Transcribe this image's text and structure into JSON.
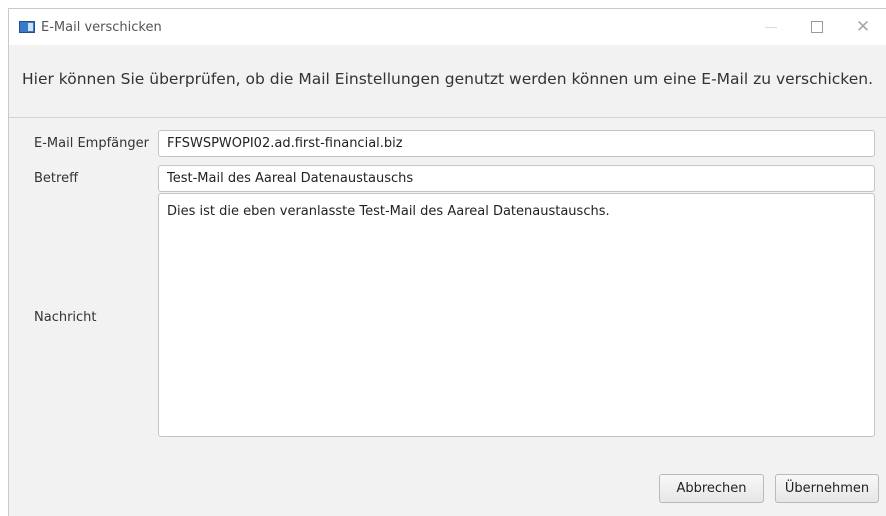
{
  "window": {
    "title": "E-Mail verschicken",
    "icon": "app-window-icon"
  },
  "header": {
    "description": "Hier können Sie überprüfen, ob die Mail Einstellungen genutzt werden können um eine E-Mail zu verschicken."
  },
  "form": {
    "recipient_label": "E-Mail Empfänger",
    "recipient_value": "FFSWSPWOPI02.ad.first-financial.biz",
    "subject_label": "Betreff",
    "subject_value": "Test-Mail des Aareal Datenaustauschs",
    "message_label": "Nachricht",
    "message_value": "Dies ist die eben veranlasste Test-Mail des Aareal Datenaustauschs."
  },
  "buttons": {
    "cancel": "Abbrechen",
    "apply": "Übernehmen"
  }
}
